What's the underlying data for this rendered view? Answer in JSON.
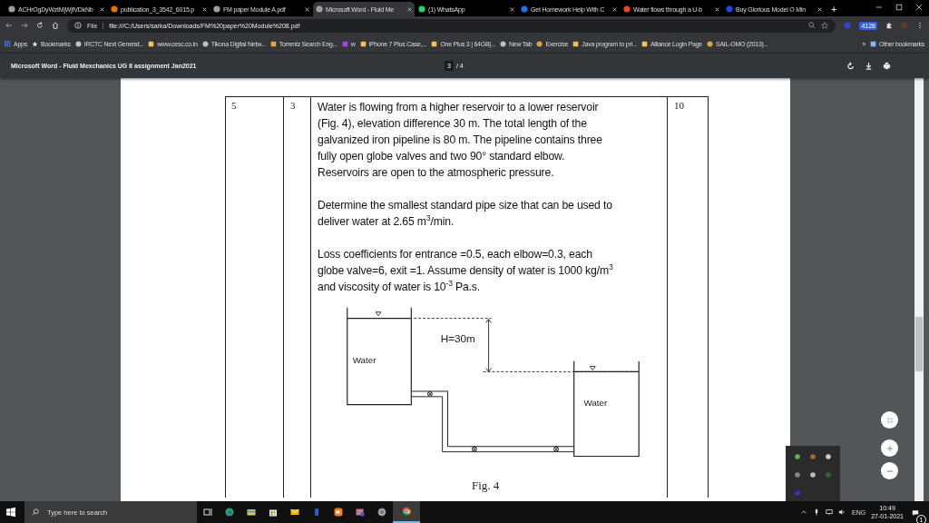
{
  "browser": {
    "tabs": [
      {
        "title": "ACHrOgDyWztMjWjfVDkNb",
        "kind": "globe",
        "selected": false
      },
      {
        "title": "publication_3_3542_6015.p",
        "kind": "doc",
        "selected": false
      },
      {
        "title": "FM paper Module A.pdf",
        "kind": "globe",
        "selected": false
      },
      {
        "title": "Microsoft Word - Fluid Me",
        "kind": "globe",
        "selected": true
      },
      {
        "title": "(1) WhatsApp",
        "kind": "chat",
        "selected": false
      },
      {
        "title": "Get Homework Help With C",
        "kind": "letter",
        "selected": false
      },
      {
        "title": "Water flows through a U-b",
        "kind": "google",
        "selected": false
      },
      {
        "title": "Buy Glorious Model O Min",
        "kind": "brand",
        "selected": false
      }
    ],
    "new_tab": "+",
    "address": {
      "scheme": "File",
      "url": "file:///C:/Users/sarka/Downloads/FM%20paper%20Module%208.pdf"
    },
    "extension_badge": "4128",
    "bookmarks": [
      {
        "label": "Apps",
        "kind": "grid"
      },
      {
        "label": "Bookmarks",
        "kind": "star"
      },
      {
        "label": "IRCTC Next Generat...",
        "kind": "globe"
      },
      {
        "label": "www.cesc.co.in",
        "kind": "site"
      },
      {
        "label": "Tikona Digital Netw...",
        "kind": "globe"
      },
      {
        "label": "Torrentz Search Eng...",
        "kind": "letter"
      },
      {
        "label": "w",
        "kind": "note"
      },
      {
        "label": "iPhone 7 Plus Case,...",
        "kind": "site"
      },
      {
        "label": "One Plus 3 | 64GB|...",
        "kind": "site"
      },
      {
        "label": "New Tab",
        "kind": "globe"
      },
      {
        "label": "Exercise",
        "kind": "shield"
      },
      {
        "label": "Java program to pri...",
        "kind": "site"
      },
      {
        "label": "Alliance Login Page",
        "kind": "site"
      },
      {
        "label": "SAIL-OMO (2013)...",
        "kind": "shield"
      }
    ],
    "bookmarks_more": "»",
    "other_bookmarks": "Other bookmarks"
  },
  "pdf_toolbar": {
    "title": "Microsoft Word - Fluid Mexchanics UG II assignment Jan2021",
    "page": "3",
    "page_total": "/ 4"
  },
  "document": {
    "row": {
      "number": "5",
      "sub_number": "3",
      "marks": "10",
      "paragraphs": [
        [
          "Water is flowing from a higher reservoir to a lower reservoir",
          "(Fig. 4), elevation difference 30 m. The total length of the",
          "galvanized iron pipeline is 80 m. The pipeline contains three",
          "fully open globe valves and two 90° standard elbow.",
          "Reservoirs are open to the atmospheric pressure."
        ],
        [
          "Determine the smallest standard pipe size that can be used to",
          "deliver water at 2.65 m$^{3}$/min."
        ],
        [
          " Loss coefficients for entrance =0.5, each elbow=0.3, each",
          "globe valve=6, exit =1. Assume density of water is 1000 kg/m$^{3}$",
          "and viscosity of water is 10$^{-3}$ Pa.s."
        ]
      ],
      "figure": {
        "upper_tank_label": "Water",
        "height_label": "H=30m",
        "lower_tank_label": "Water"
      },
      "caption": "Fig. 4"
    }
  },
  "taskbar": {
    "search_placeholder": "Type here to search",
    "language": "ENG",
    "time": "10:49",
    "date": "27-01-2021",
    "notification_count": "1"
  }
}
